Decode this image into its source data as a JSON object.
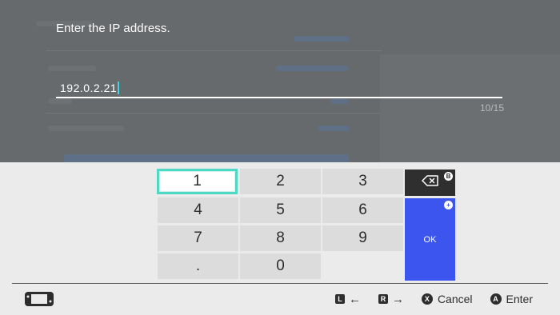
{
  "dialog": {
    "prompt": "Enter the IP address.",
    "value": "192.0.2.21",
    "counter": "10/15"
  },
  "keypad": {
    "keys": [
      "1",
      "2",
      "3",
      "4",
      "5",
      "6",
      "7",
      "8",
      "9",
      ".",
      "0"
    ],
    "selected_key": "1",
    "ok_label": "OK",
    "backspace_icon": "backspace-icon",
    "backspace_button_glyph": "B",
    "ok_button_glyph": "+"
  },
  "footer": {
    "console_icon": "handheld-console-icon",
    "hints": [
      {
        "glyph": "L",
        "label": "←"
      },
      {
        "glyph": "R",
        "label": "→"
      },
      {
        "glyph": "X",
        "label": "Cancel"
      },
      {
        "glyph": "A",
        "label": "Enter"
      }
    ]
  },
  "colors": {
    "overlay": "#676a6c",
    "keypad_bg": "#ebebeb",
    "key_bg": "#dcdcdc",
    "selected_border": "#4fd9c4",
    "ok_blue": "#3b55ee",
    "caret": "#3fd6e0"
  }
}
